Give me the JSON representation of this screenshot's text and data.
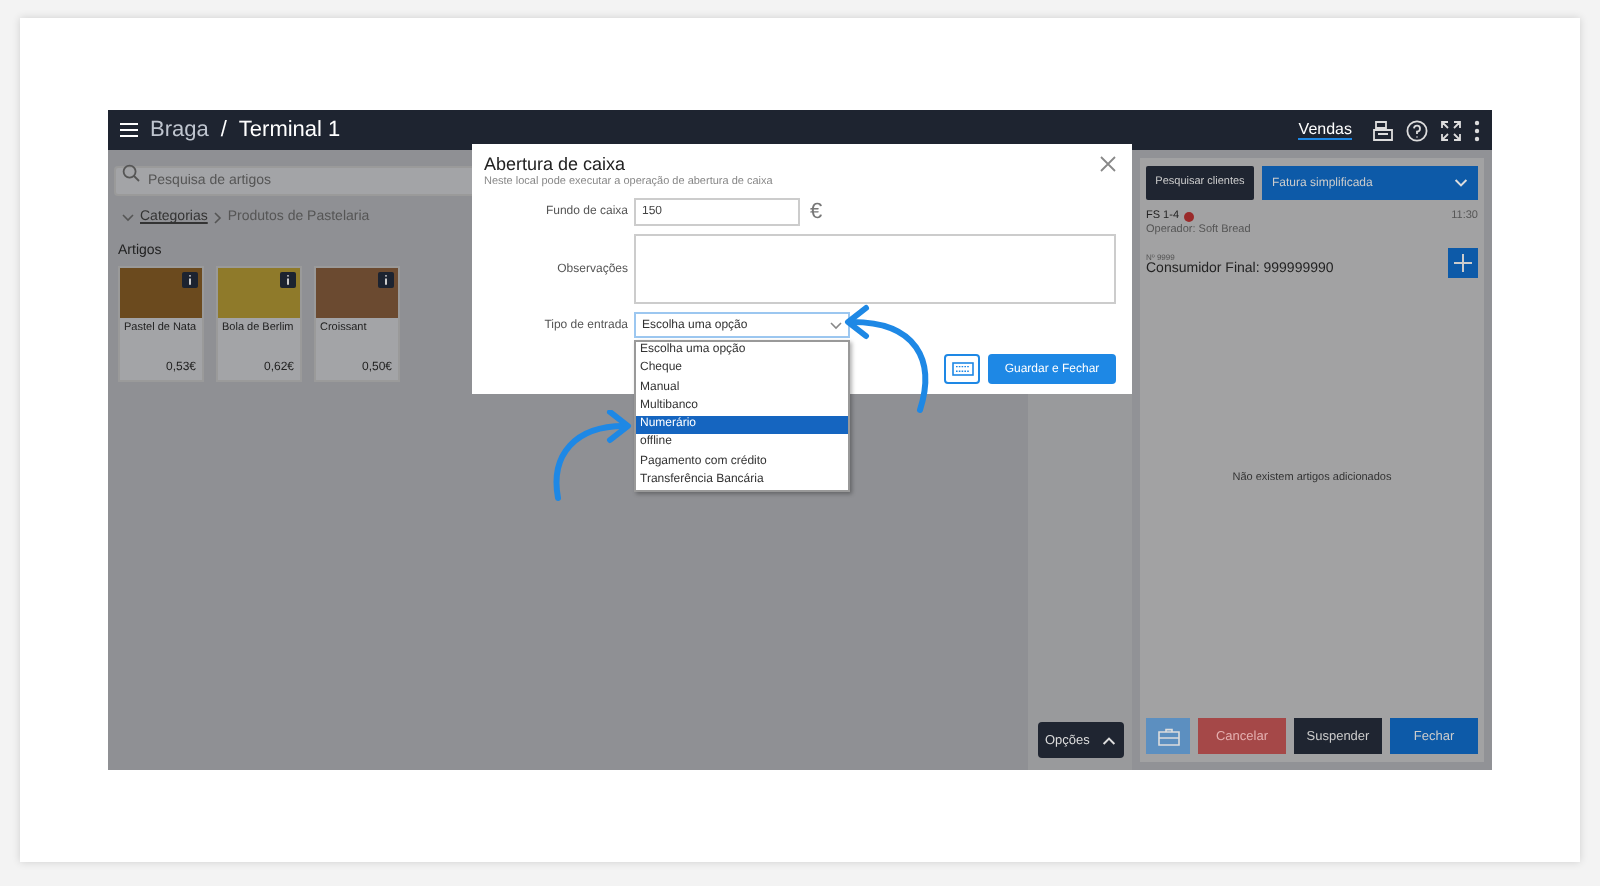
{
  "header": {
    "location": "Braga",
    "separator": "/",
    "terminal": "Terminal 1",
    "nav_link": "Vendas"
  },
  "search": {
    "placeholder": "Pesquisa de artigos"
  },
  "breadcrumb": [
    "Categorias",
    "Produtos de Pastelaria"
  ],
  "section_title": "Artigos",
  "articles": [
    {
      "name": "Pastel de Nata",
      "price": "0,53€"
    },
    {
      "name": "Bola de Berlim",
      "price": "0,62€"
    },
    {
      "name": "Croissant",
      "price": "0,50€"
    }
  ],
  "options_button": "Opções",
  "sale": {
    "search_clients": "Pesquisar clientes",
    "doc_type": "Fatura simplificada",
    "doc_number": "FS 1-4",
    "time": "11:30",
    "operator": "Operador: Soft Bread",
    "customer_number": "Nº 9999",
    "customer": "Consumidor Final: 999999990",
    "empty": "Não existem artigos adicionados",
    "buttons": [
      {
        "label": "Cancelar",
        "kind": "danger"
      },
      {
        "label": "Suspender",
        "kind": "dark"
      },
      {
        "label": "Fechar",
        "kind": "primary"
      }
    ]
  },
  "modal": {
    "title": "Abertura de caixa",
    "subtitle": "Neste local pode executar a operação de abertura de caixa",
    "currency": "€",
    "fields": [
      {
        "label": "Fundo de caixa",
        "kind": "text",
        "value": "150"
      },
      {
        "label": "Observações",
        "kind": "textarea"
      },
      {
        "label": "Tipo de entrada",
        "kind": "select",
        "value": "Escolha uma opção"
      }
    ],
    "save_button": "Guardar e Fechar",
    "options": [
      {
        "label": "Escolha uma opção",
        "selected": false
      },
      {
        "label": "Cheque",
        "selected": false
      },
      {
        "label": "Manual",
        "selected": false
      },
      {
        "label": "Multibanco",
        "selected": false
      },
      {
        "label": "Numerário",
        "selected": true
      },
      {
        "label": "offline",
        "selected": false
      },
      {
        "label": "Pagamento com crédito",
        "selected": false
      },
      {
        "label": "Transferência Bancária",
        "selected": false
      }
    ]
  }
}
